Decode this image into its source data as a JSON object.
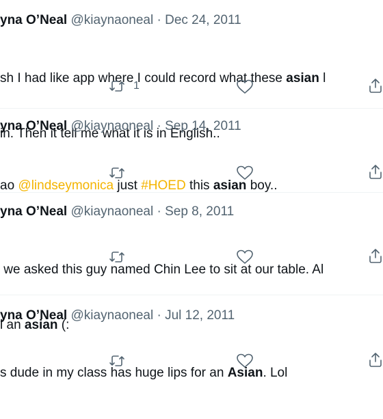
{
  "tweets": [
    {
      "name": "yna O’Neal",
      "handle": "@kiaynaoneal",
      "separator": "·",
      "date": "Dec 24, 2011",
      "lines": [
        [
          {
            "t": "sh I had like app where I could record what these "
          },
          {
            "t": "asian",
            "b": true
          },
          {
            "t": " l"
          }
        ],
        [
          {
            "t": "in. Then it tell me what it is in English.."
          }
        ]
      ],
      "retweet_count": "1"
    },
    {
      "name": "yna O’Neal",
      "handle": "@kiaynaoneal",
      "separator": "·",
      "date": "Sep 14, 2011",
      "lines": [
        [
          {
            "t": "ao "
          },
          {
            "t": "@lindseymonica",
            "link": true
          },
          {
            "t": " just "
          },
          {
            "t": "#HOED",
            "link": true
          },
          {
            "t": " this "
          },
          {
            "t": "asian",
            "b": true
          },
          {
            "t": " boy.."
          }
        ]
      ],
      "retweet_count": ""
    },
    {
      "name": "yna O’Neal",
      "handle": "@kiaynaoneal",
      "separator": "·",
      "date": "Sep 8, 2011",
      "lines": [
        [
          {
            "t": " we asked this guy named Chin Lee to sit at our table. Al"
          }
        ],
        [
          {
            "t": "l an "
          },
          {
            "t": "asian",
            "b": true
          },
          {
            "t": " (:"
          }
        ]
      ],
      "retweet_count": ""
    },
    {
      "name": "yna O’Neal",
      "handle": "@kiaynaoneal",
      "separator": "·",
      "date": "Jul 12, 2011",
      "lines": [
        [
          {
            "t": "s dude in my class has huge lips for an "
          },
          {
            "t": "Asian",
            "b": true
          },
          {
            "t": ". Lol"
          }
        ]
      ],
      "retweet_count": ""
    }
  ],
  "icons": [
    "retweet-icon",
    "like-icon",
    "share-icon"
  ],
  "colors": {
    "link": "#f4b400",
    "secondary": "#536471",
    "divider": "#eff3f4"
  }
}
